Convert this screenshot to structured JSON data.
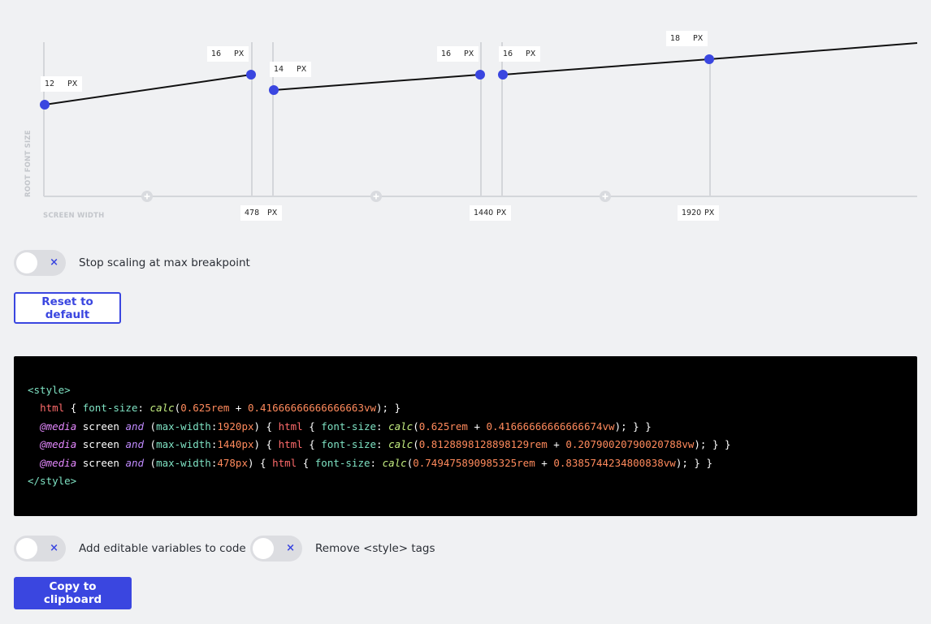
{
  "graph": {
    "y_axis_title": "ROOT FONT SIZE",
    "x_axis_title": "SCREEN WIDTH",
    "unit": "PX",
    "points": [
      {
        "value": "12"
      },
      {
        "value": "16"
      },
      {
        "value": "14"
      },
      {
        "value": "16"
      },
      {
        "value": "16"
      },
      {
        "value": "18"
      }
    ],
    "breakpoints": [
      {
        "value": "478"
      },
      {
        "value": "1440"
      },
      {
        "value": "1920"
      }
    ]
  },
  "controls": {
    "stop_scaling_label": "Stop scaling at max breakpoint",
    "reset_label": "Reset to default",
    "editable_vars_label": "Add editable variables to code",
    "remove_style_label": "Remove <style> tags",
    "copy_label": "Copy to clipboard",
    "toggle_off_glyph": "×"
  },
  "code": {
    "open_tag": "<style>",
    "close_tag": "</style>",
    "line1": {
      "selector": "html",
      "prop": "font-size",
      "fn": "calc",
      "rem": "0.625rem",
      "vw": "0.41666666666666663vw"
    },
    "media": [
      {
        "at": "@media",
        "screen": "screen",
        "and": "and",
        "feature": "max-width",
        "bp": "1920px",
        "selector": "html",
        "prop": "font-size",
        "fn": "calc",
        "rem": "0.625rem",
        "vw": "0.41666666666666674vw"
      },
      {
        "at": "@media",
        "screen": "screen",
        "and": "and",
        "feature": "max-width",
        "bp": "1440px",
        "selector": "html",
        "prop": "font-size",
        "fn": "calc",
        "rem": "0.8128898128898129rem",
        "vw": "0.20790020790020788vw"
      },
      {
        "at": "@media",
        "screen": "screen",
        "and": "and",
        "feature": "max-width",
        "bp": "478px",
        "selector": "html",
        "prop": "font-size",
        "fn": "calc",
        "rem": "0.749475890985325rem",
        "vw": "0.8385744234800838vw"
      }
    ]
  },
  "colors": {
    "accent": "#3a46e0",
    "background": "#f0f1f3",
    "code_background": "#000000"
  }
}
